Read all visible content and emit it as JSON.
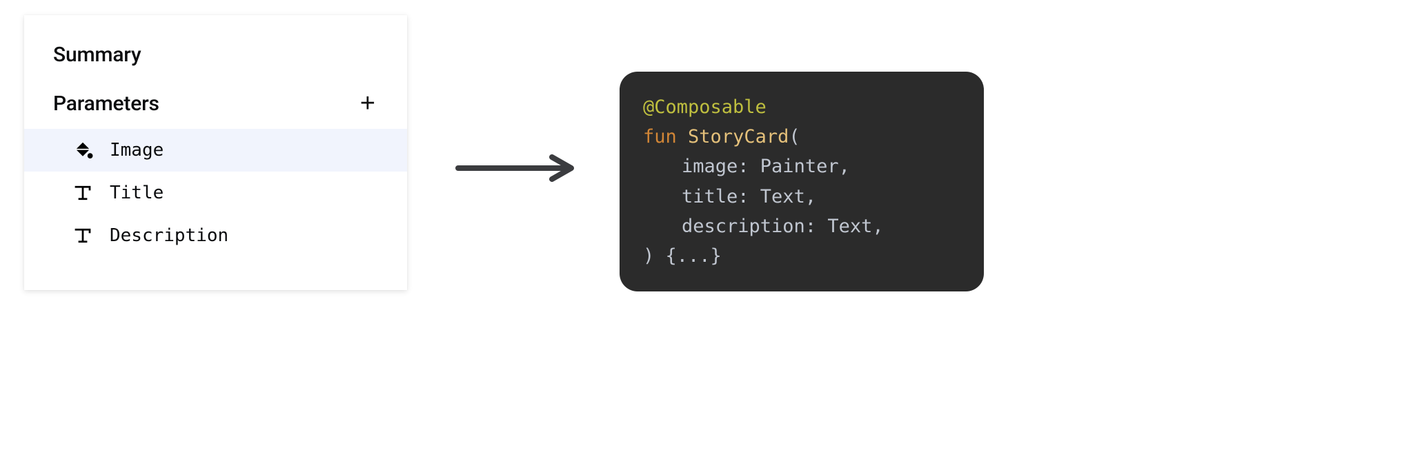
{
  "panel": {
    "heading": "Summary",
    "section": {
      "title": "Parameters",
      "add_label": "+"
    },
    "rows": [
      {
        "icon": "fill",
        "label": "Image",
        "selected": true
      },
      {
        "icon": "text",
        "label": "Title",
        "selected": false
      },
      {
        "icon": "text",
        "label": "Description",
        "selected": false
      }
    ]
  },
  "code": {
    "annotation": "@Composable",
    "keyword_fun": "fun",
    "fn_name": "StoryCard",
    "params": [
      {
        "name": "image",
        "type": "Painter"
      },
      {
        "name": "title",
        "type": "Text"
      },
      {
        "name": "description",
        "type": "Text"
      }
    ],
    "body_text": "{...}"
  }
}
